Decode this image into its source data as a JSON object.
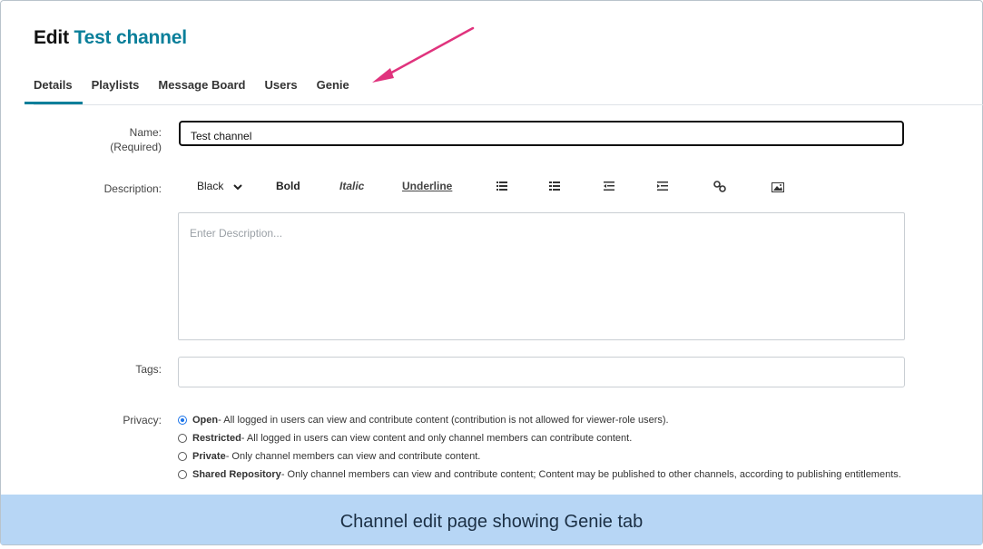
{
  "page": {
    "title_prefix": "Edit",
    "channel_name": "Test channel"
  },
  "tabs": [
    {
      "label": "Details"
    },
    {
      "label": "Playlists"
    },
    {
      "label": "Message Board"
    },
    {
      "label": "Users"
    },
    {
      "label": "Genie"
    }
  ],
  "form": {
    "name_label": "Name:",
    "name_required": "(Required)",
    "name_value": "Test channel",
    "description_label": "Description:",
    "description_placeholder": "Enter Description...",
    "tags_label": "Tags:",
    "tags_value": "",
    "privacy_label": "Privacy:"
  },
  "toolbar": {
    "color_select": "Black",
    "bold": "Bold",
    "italic": "Italic",
    "underline": "Underline",
    "icons": [
      "bulleted-list-icon",
      "numbered-list-icon",
      "outdent-icon",
      "indent-icon",
      "link-icon",
      "image-icon"
    ]
  },
  "privacy_options": [
    {
      "name": "Open",
      "desc": " - All logged in users can view and contribute content (contribution is not allowed for viewer-role users).",
      "selected": true
    },
    {
      "name": "Restricted",
      "desc": " - All logged in users can view content and only channel members can contribute content.",
      "selected": false
    },
    {
      "name": "Private",
      "desc": " - Only channel members can view and contribute content.",
      "selected": false
    },
    {
      "name": "Shared Repository",
      "desc": " - Only channel members can view and contribute content; Content may be published to other channels, according to publishing entitlements.",
      "selected": false
    }
  ],
  "caption": "Channel edit page showing Genie tab",
  "colors": {
    "accent": "#0a7f9a",
    "arrow": "#e0337d",
    "caption_bg": "#b7d6f5",
    "radio": "#1a73e8"
  }
}
